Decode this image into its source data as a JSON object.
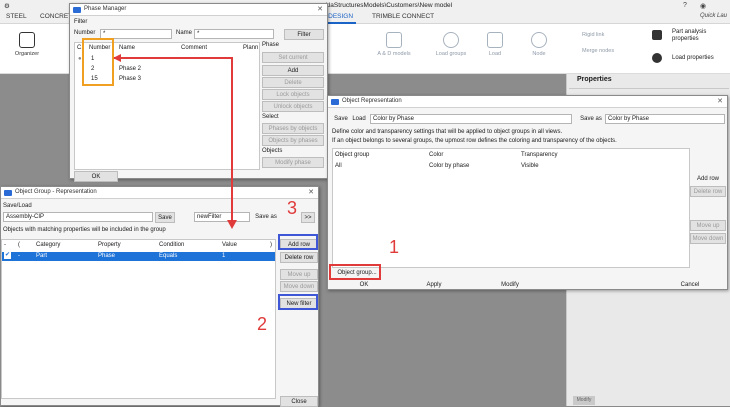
{
  "topbar": {
    "tabs": [
      "STEEL",
      "CONCRET",
      "...",
      "...",
      "ekla",
      "DESIGN",
      "TRIMBLE CONNECT"
    ],
    "title": "eklaStructuresModels\\Customers\\New model",
    "quick_launch": "Quick Lau",
    "design_tab": "& DESIGN",
    "trimble_tab": "TRIMBLE CONNECT"
  },
  "ribbon": {
    "organizer": "Organizer",
    "a_d_models": "A & D models",
    "load_groups": "Load groups",
    "load": "Load",
    "node": "Node",
    "rigid_link": "Rigid link",
    "merge_nodes": "Merge nodes",
    "part_analysis": "Part analysis properties",
    "load_properties": "Load properties"
  },
  "properties_panel": {
    "title": "Properties",
    "modify": "Modify"
  },
  "phase_manager": {
    "title": "Phase Manager",
    "filter_label": "Filter",
    "number_label": "Number",
    "number_value": "*",
    "name_label": "Name",
    "name_value": "*",
    "filter_button": "Filter",
    "columns": [
      "C.",
      "Number",
      "Name",
      "Comment",
      "Plann"
    ],
    "rows": [
      {
        "number": "1",
        "name": ""
      },
      {
        "number": "2",
        "name": "Phase 2"
      },
      {
        "number": "15",
        "name": "Phase 3"
      }
    ],
    "phase_section": "Phase",
    "set_current": "Set current",
    "add": "Add",
    "delete": "Delete",
    "lock_objects": "Lock objects",
    "unlock_objects": "Unlock objects",
    "select_section": "Select",
    "phases_by_objects": "Phases by objects",
    "objects_by_phases": "Objects by phases",
    "objects_section": "Objects",
    "modify_phase": "Modify phase",
    "ok": "OK"
  },
  "object_group": {
    "title": "Object Group - Representation",
    "save_load": "Save/Load",
    "preset": "Assembly-CIP",
    "save": "Save",
    "save_as_value": "newFilter",
    "save_as": "Save as",
    "more": ">>",
    "info": "Objects with matching properties will be included in the group",
    "columns": [
      "-",
      "(",
      "Category",
      "Property",
      "Condition",
      "Value",
      ")"
    ],
    "rows": [
      {
        "check": "✔",
        "dash": "-",
        "category": "Part",
        "property": "Phase",
        "condition": "Equals",
        "value": "1"
      }
    ],
    "add_row": "Add row",
    "delete_row": "Delete row",
    "move_up": "Move up",
    "move_down": "Move down",
    "new_filter": "New filter",
    "close": "Close"
  },
  "object_rep": {
    "title": "Object Representation",
    "save": "Save",
    "load": "Load",
    "preset": "Color by Phase",
    "save_as": "Save as",
    "save_as_value": "Color by Phase",
    "desc1": "Define color and transparency settings that will be applied to object groups in all views.",
    "desc2": "If an object belongs to several groups, the upmost row defines the coloring and transparency of the objects.",
    "columns": [
      "Object group",
      "Color",
      "Transparency"
    ],
    "rows": [
      {
        "group": "All",
        "color": "Color by phase",
        "transparency": "Visible"
      }
    ],
    "add_row": "Add row",
    "delete_row": "Delete row",
    "move_up": "Move up",
    "move_down": "Move down",
    "object_group_btn": "Object group...",
    "ok": "OK",
    "apply": "Apply",
    "modify": "Modify",
    "cancel": "Cancel"
  },
  "annotations": {
    "n1": "1",
    "n2": "2",
    "n3": "3"
  },
  "colors": {
    "accent_red": "#e03a3a",
    "highlight_blue": "#3d57d6",
    "highlight_orange": "#f0a020",
    "selection_blue": "#1e73d8"
  }
}
